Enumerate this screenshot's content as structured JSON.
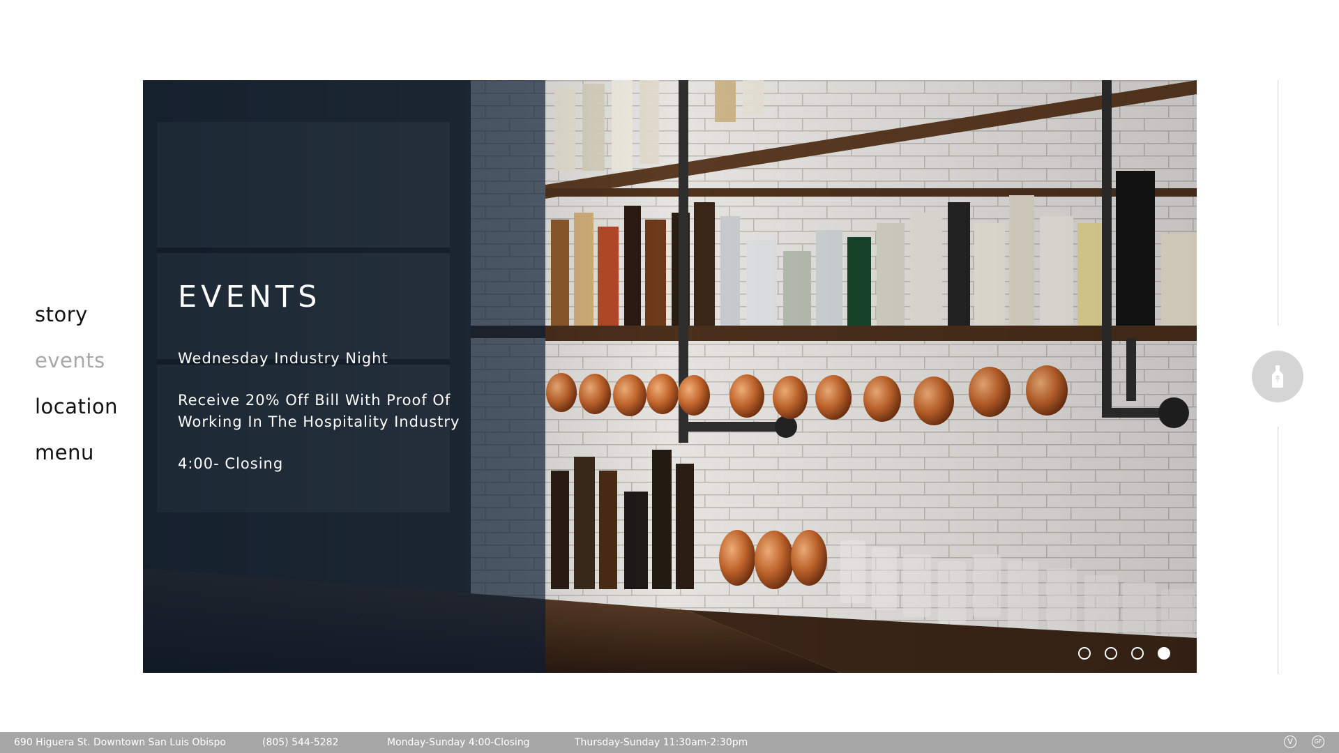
{
  "nav": {
    "items": [
      {
        "label": "story",
        "active": false
      },
      {
        "label": "events",
        "active": true
      },
      {
        "label": "location",
        "active": false
      },
      {
        "label": "menu",
        "active": false
      }
    ]
  },
  "hero": {
    "image": "bar-shelves-with-liquor-bottles-and-copper-mugs",
    "title": "EVENTS",
    "lines": [
      "Wednesday Industry Night",
      "Receive 20% Off Bill With Proof Of Working In The Hospitality Industry",
      "4:00- Closing"
    ],
    "slides": {
      "count": 4,
      "active_index": 3
    }
  },
  "side": {
    "button_icon": "bottle-icon"
  },
  "footer": {
    "address": "690 Higuera St. Downtown San Luis Obispo",
    "phone": "(805) 544-5282",
    "hours": "Monday-Sunday 4:00-Closing",
    "lunch_hours": "Thursday-Sunday 11:30am-2:30pm",
    "badges": [
      "V",
      "GF"
    ]
  },
  "colors": {
    "overlay": "#0a1e34",
    "footer_bg": "#a6a6a6",
    "nav_active": "#a8a8a8",
    "nav_text": "#111111",
    "side_button": "#d5d5d5"
  }
}
